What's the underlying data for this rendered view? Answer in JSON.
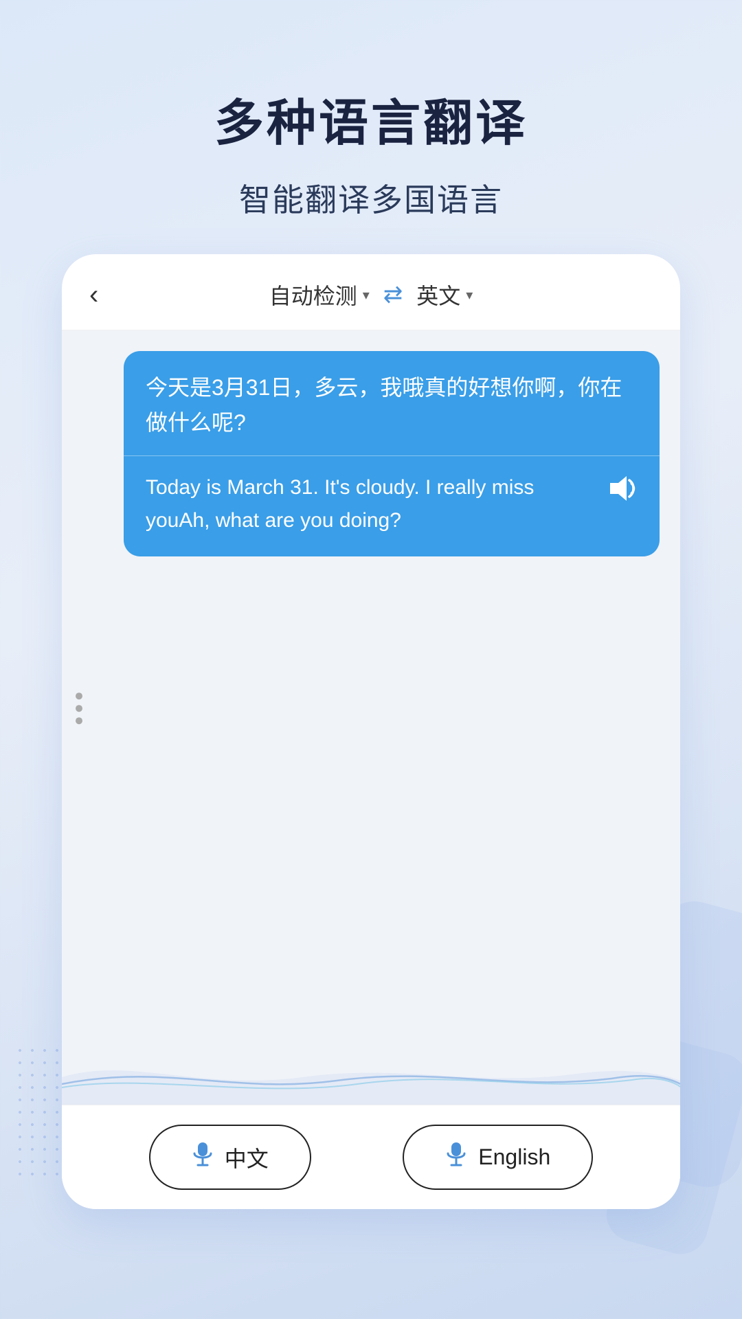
{
  "page": {
    "background": "#dce8f8"
  },
  "header": {
    "main_title": "多种语言翻译",
    "sub_title": "智能翻译多国语言"
  },
  "app": {
    "back_label": "‹",
    "source_lang": "自动检测",
    "target_lang": "英文",
    "source_lang_arrow": "▾",
    "target_lang_arrow": "▾",
    "swap_icon": "⇄",
    "three_dots": [
      "•",
      "•",
      "•"
    ],
    "original_text": "今天是3月31日，多云，我哦真的好想你啊，你在做什么呢?",
    "translated_text": "Today is March 31. It's cloudy. I really miss youAh, what are you doing?",
    "speaker_icon": "🔊"
  },
  "bottom_bar": {
    "chinese_btn": "中文",
    "english_btn": "English",
    "mic_label": "mic"
  }
}
